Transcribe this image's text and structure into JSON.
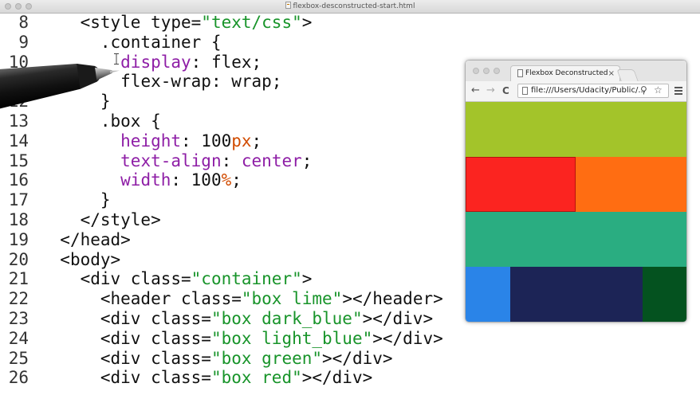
{
  "editor": {
    "window_title": "flexbox-desconstructed-start.html",
    "lines": [
      {
        "num": "8",
        "indent": "    ",
        "tokens": [
          {
            "t": "<style type="
          },
          {
            "t": "\"text/css\"",
            "c": "str"
          },
          {
            "t": ">"
          }
        ]
      },
      {
        "num": "9",
        "indent": "      ",
        "tokens": [
          {
            "t": ".container {"
          }
        ]
      },
      {
        "num": "10",
        "indent": "        ",
        "tokens": [
          {
            "t": "display",
            "c": "prop"
          },
          {
            "t": ": flex;"
          }
        ]
      },
      {
        "num": "11",
        "indent": "        ",
        "tokens": [
          {
            "t": "flex-wrap: wrap;"
          }
        ]
      },
      {
        "num": "12",
        "indent": "      ",
        "tokens": [
          {
            "t": "}"
          }
        ]
      },
      {
        "num": "13",
        "indent": "      ",
        "tokens": [
          {
            "t": ".box {"
          }
        ]
      },
      {
        "num": "14",
        "indent": "        ",
        "tokens": [
          {
            "t": "height",
            "c": "prop"
          },
          {
            "t": ": 100"
          },
          {
            "t": "px",
            "c": "unit"
          },
          {
            "t": ";"
          }
        ]
      },
      {
        "num": "15",
        "indent": "        ",
        "tokens": [
          {
            "t": "text-align",
            "c": "prop"
          },
          {
            "t": ": "
          },
          {
            "t": "center",
            "c": "prop"
          },
          {
            "t": ";"
          }
        ]
      },
      {
        "num": "16",
        "indent": "        ",
        "tokens": [
          {
            "t": "width",
            "c": "prop"
          },
          {
            "t": ": 100"
          },
          {
            "t": "%",
            "c": "unit"
          },
          {
            "t": ";"
          }
        ]
      },
      {
        "num": "17",
        "indent": "      ",
        "tokens": [
          {
            "t": "}"
          }
        ]
      },
      {
        "num": "18",
        "indent": "    ",
        "tokens": [
          {
            "t": "</style>"
          }
        ]
      },
      {
        "num": "19",
        "indent": "  ",
        "tokens": [
          {
            "t": "</head>"
          }
        ]
      },
      {
        "num": "20",
        "indent": "  ",
        "tokens": [
          {
            "t": "<body>"
          }
        ]
      },
      {
        "num": "21",
        "indent": "    ",
        "tokens": [
          {
            "t": "<div class="
          },
          {
            "t": "\"container\"",
            "c": "str"
          },
          {
            "t": ">"
          }
        ]
      },
      {
        "num": "22",
        "indent": "      ",
        "tokens": [
          {
            "t": "<header class="
          },
          {
            "t": "\"box lime\"",
            "c": "str"
          },
          {
            "t": "></header>"
          }
        ]
      },
      {
        "num": "23",
        "indent": "      ",
        "tokens": [
          {
            "t": "<div class="
          },
          {
            "t": "\"box dark_blue\"",
            "c": "str"
          },
          {
            "t": "></div>"
          }
        ]
      },
      {
        "num": "24",
        "indent": "      ",
        "tokens": [
          {
            "t": "<div class="
          },
          {
            "t": "\"box light_blue\"",
            "c": "str"
          },
          {
            "t": "></div>"
          }
        ]
      },
      {
        "num": "25",
        "indent": "      ",
        "tokens": [
          {
            "t": "<div class="
          },
          {
            "t": "\"box green\"",
            "c": "str"
          },
          {
            "t": "></div>"
          }
        ]
      },
      {
        "num": "26",
        "indent": "      ",
        "tokens": [
          {
            "t": "<div class="
          },
          {
            "t": "\"box red\"",
            "c": "str"
          },
          {
            "t": "></div>"
          }
        ]
      }
    ]
  },
  "browser": {
    "tab_title": "Flexbox Deconstructed",
    "tab_close": "×",
    "back_icon": "←",
    "forward_icon": "→",
    "reload_icon": "C",
    "url": "file:///Users/Udacity/Public/...",
    "search_icon": "⚲",
    "star_icon": "☆",
    "boxes": [
      {
        "name": "lime",
        "color": "#a3c42a"
      },
      {
        "name": "red",
        "color": "#fb2420"
      },
      {
        "name": "orange",
        "color": "#ff6d12"
      },
      {
        "name": "green",
        "color": "#2aad81"
      },
      {
        "name": "light_blue",
        "color": "#2a84e8"
      },
      {
        "name": "dark_blue",
        "color": "#1c2456"
      },
      {
        "name": "dark_green",
        "color": "#04521f"
      }
    ]
  },
  "colors": {
    "string": "#18942a",
    "property": "#8e1ea6",
    "unit": "#d14b00"
  }
}
